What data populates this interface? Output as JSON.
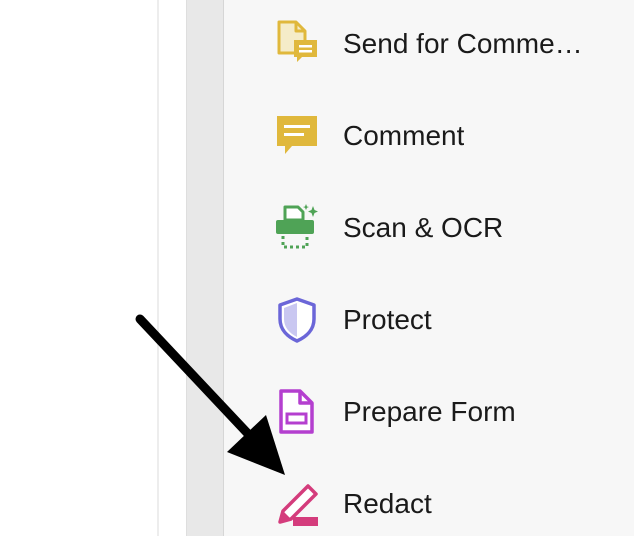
{
  "tools": [
    {
      "label": "Send for Comme…",
      "icon": "send-for-comments-icon",
      "color": "#e0b83c"
    },
    {
      "label": "Comment",
      "icon": "comment-icon",
      "color": "#e0b83c"
    },
    {
      "label": "Scan & OCR",
      "icon": "scan-ocr-icon",
      "color": "#4fa356"
    },
    {
      "label": "Protect",
      "icon": "protect-shield-icon",
      "color": "#6b66d8"
    },
    {
      "label": "Prepare Form",
      "icon": "prepare-form-icon",
      "color": "#b43fcf"
    },
    {
      "label": "Redact",
      "icon": "redact-icon",
      "color": "#d43c7c"
    }
  ],
  "annotation": {
    "arrow_color": "#000000"
  }
}
